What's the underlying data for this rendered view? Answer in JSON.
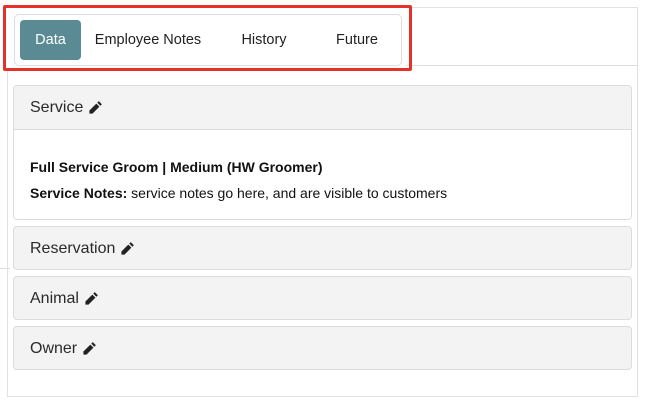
{
  "tabs": [
    {
      "label": "Data",
      "active": true
    },
    {
      "label": "Employee Notes",
      "active": false
    },
    {
      "label": "History",
      "active": false
    },
    {
      "label": "Future",
      "active": false
    }
  ],
  "panels": {
    "service": {
      "title": "Service",
      "service_name": "Full Service Groom | Medium (HW Groomer)",
      "notes_label": "Service Notes:",
      "notes_text": " service notes go here, and are visible to customers"
    },
    "reservation": {
      "title": "Reservation"
    },
    "animal": {
      "title": "Animal"
    },
    "owner": {
      "title": "Owner"
    }
  },
  "colors": {
    "active_tab": "#5a8a93",
    "highlight": "#e4322b",
    "panel_header_bg": "#f3f3f3"
  },
  "icons": {
    "edit": "pencil-icon"
  }
}
